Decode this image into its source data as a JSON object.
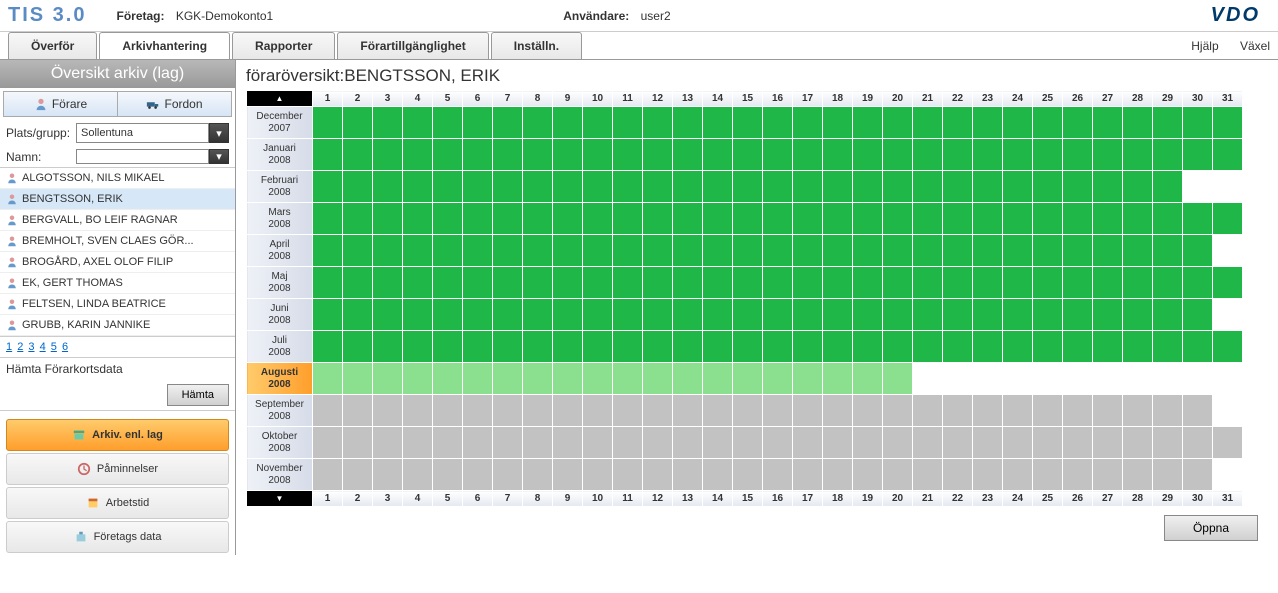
{
  "app_title": "TIS 3.0",
  "top": {
    "company_label": "Företag:",
    "company_value": "KGK-Demokonto1",
    "user_label": "Användare:",
    "user_value": "user2",
    "brand": "VDO"
  },
  "tabs": [
    "Överför",
    "Arkivhantering",
    "Rapporter",
    "Förartillgänglighet",
    "Inställn."
  ],
  "active_tab_index": 1,
  "right_links": {
    "help": "Hjälp",
    "switch": "Växel"
  },
  "sidebar": {
    "title": "Översikt arkiv (lag)",
    "toggle": {
      "drivers": "Förare",
      "vehicles": "Fordon"
    },
    "filter_place_label": "Plats/grupp:",
    "filter_place_value": "Sollentuna",
    "filter_name_label": "Namn:",
    "filter_name_value": "",
    "drivers": [
      "ALGOTSSON, NILS MIKAEL",
      "BENGTSSON, ERIK",
      "BERGVALL, BO LEIF RAGNAR",
      "BREMHOLT, SVEN CLAES GÖR...",
      "BROGÅRD, AXEL OLOF FILIP",
      "EK, GERT THOMAS",
      "FELTSEN, LINDA BEATRICE",
      "GRUBB, KARIN JANNIKE"
    ],
    "selected_driver_index": 1,
    "pager": [
      "1",
      "2",
      "3",
      "4",
      "5",
      "6"
    ],
    "fetch_label": "Hämta Förarkortsdata",
    "fetch_btn": "Hämta",
    "nav": [
      "Arkiv. enl. lag",
      "Påminnelser",
      "Arbetstid",
      "Företags data"
    ],
    "active_nav_index": 0
  },
  "content": {
    "title_prefix": "föraröversikt:",
    "title_name": "BENGTSSON, ERIK",
    "days": [
      "1",
      "2",
      "3",
      "4",
      "5",
      "6",
      "7",
      "8",
      "9",
      "10",
      "11",
      "12",
      "13",
      "14",
      "15",
      "16",
      "17",
      "18",
      "19",
      "20",
      "21",
      "22",
      "23",
      "24",
      "25",
      "26",
      "27",
      "28",
      "29",
      "30",
      "31"
    ],
    "months": [
      {
        "label1": "December",
        "label2": "2007",
        "days": 31,
        "fill": "g",
        "sel": false
      },
      {
        "label1": "Januari",
        "label2": "2008",
        "days": 31,
        "fill": "g",
        "sel": false
      },
      {
        "label1": "Februari",
        "label2": "2008",
        "days": 29,
        "fill": "g",
        "sel": false
      },
      {
        "label1": "Mars",
        "label2": "2008",
        "days": 31,
        "fill": "g",
        "sel": false
      },
      {
        "label1": "April",
        "label2": "2008",
        "days": 30,
        "fill": "g",
        "sel": false
      },
      {
        "label1": "Maj",
        "label2": "2008",
        "days": 31,
        "fill": "g",
        "sel": false
      },
      {
        "label1": "Juni",
        "label2": "2008",
        "days": 30,
        "fill": "g",
        "sel": false
      },
      {
        "label1": "Juli",
        "label2": "2008",
        "days": 31,
        "fill": "g",
        "sel": false
      },
      {
        "label1": "Augusti",
        "label2": "2008",
        "days": 31,
        "fill": "lg",
        "sel": true,
        "partial": 20
      },
      {
        "label1": "September",
        "label2": "2008",
        "days": 30,
        "fill": "gr",
        "sel": false
      },
      {
        "label1": "Oktober",
        "label2": "2008",
        "days": 31,
        "fill": "gr",
        "sel": false
      },
      {
        "label1": "November",
        "label2": "2008",
        "days": 30,
        "fill": "gr",
        "sel": false
      }
    ],
    "open_btn": "Öppna"
  }
}
